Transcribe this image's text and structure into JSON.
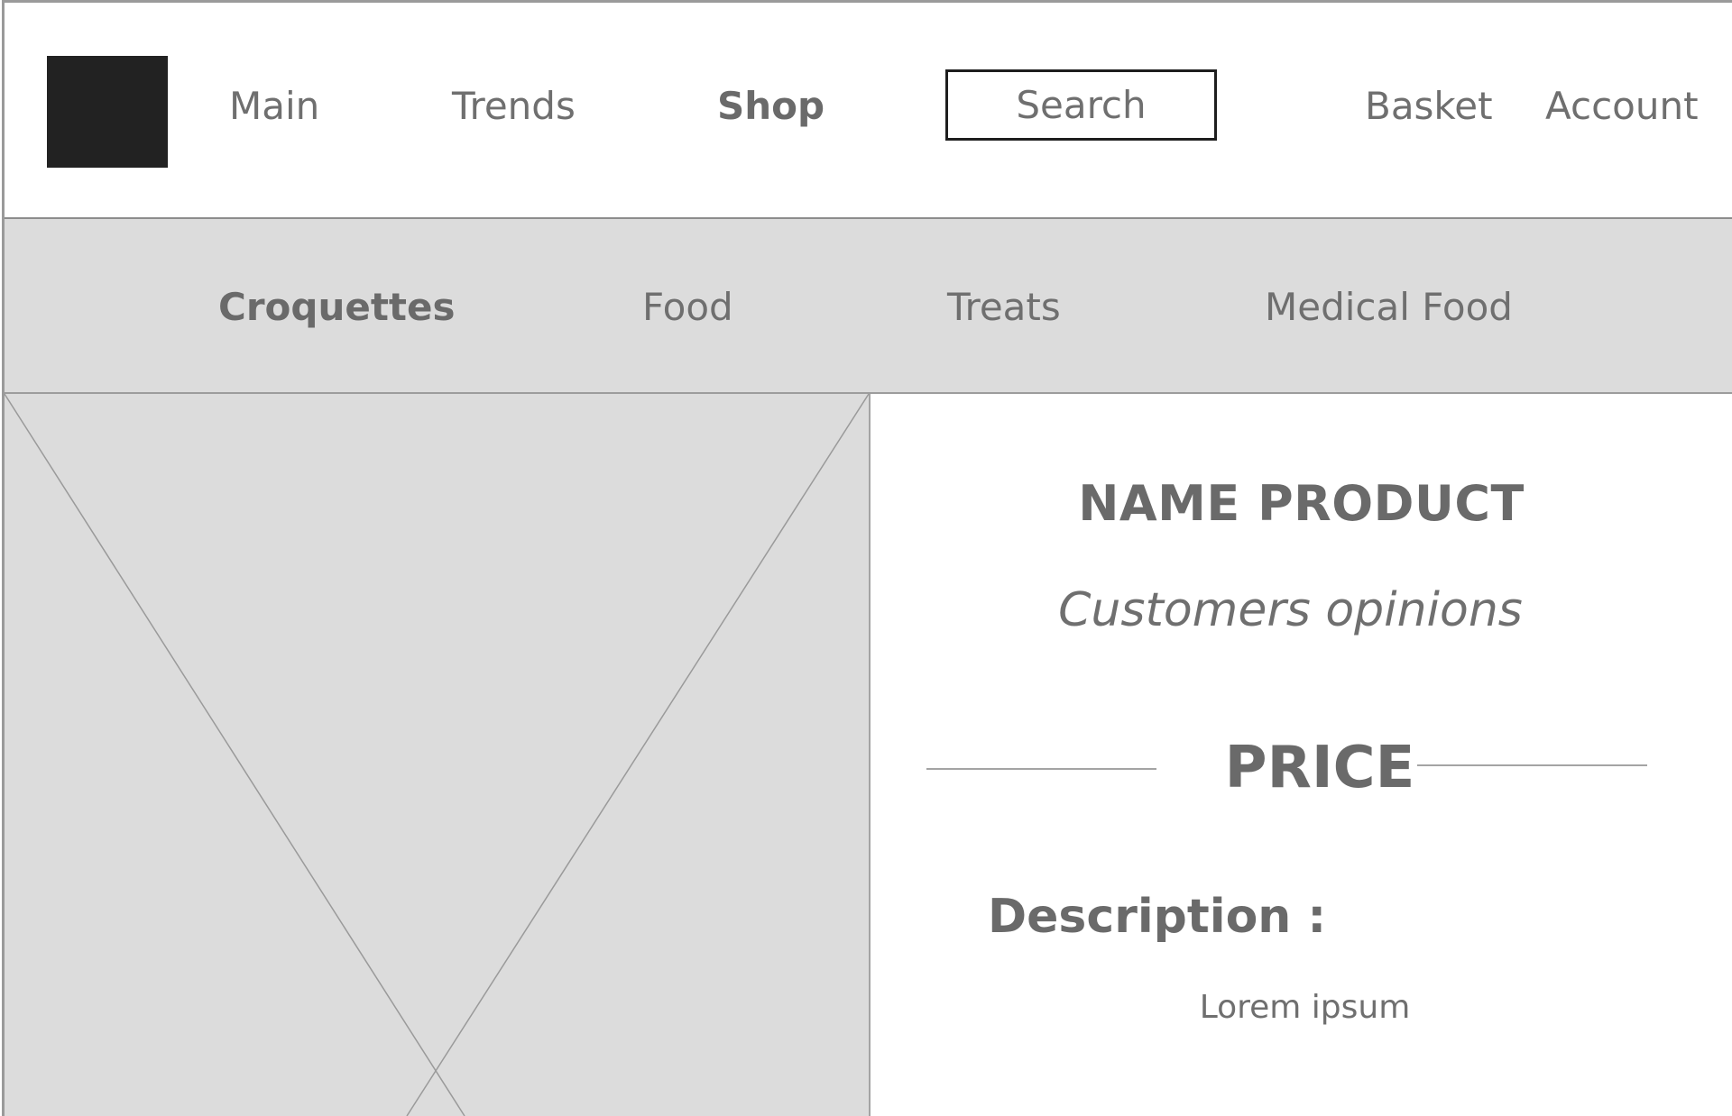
{
  "header": {
    "logo": "logo-placeholder",
    "nav": [
      {
        "label": "Main"
      },
      {
        "label": "Trends"
      },
      {
        "label": "Shop",
        "active": true
      }
    ],
    "search": {
      "placeholder": "Search"
    },
    "basket_label": "Basket",
    "account_label": "Account"
  },
  "categories": [
    {
      "label": "Croquettes",
      "active": true
    },
    {
      "label": "Food"
    },
    {
      "label": "Treats"
    },
    {
      "label": "Medical Food"
    }
  ],
  "product": {
    "image": "image-placeholder",
    "name": "NAME PRODUCT",
    "opinions_label": "Customers opinions",
    "price_label": "PRICE",
    "description_label": "Description :",
    "description_text": "Lorem ipsum"
  },
  "colors": {
    "logo": "#222222",
    "category_bar": "#dcdcdc",
    "text": "#6f6f6f"
  }
}
